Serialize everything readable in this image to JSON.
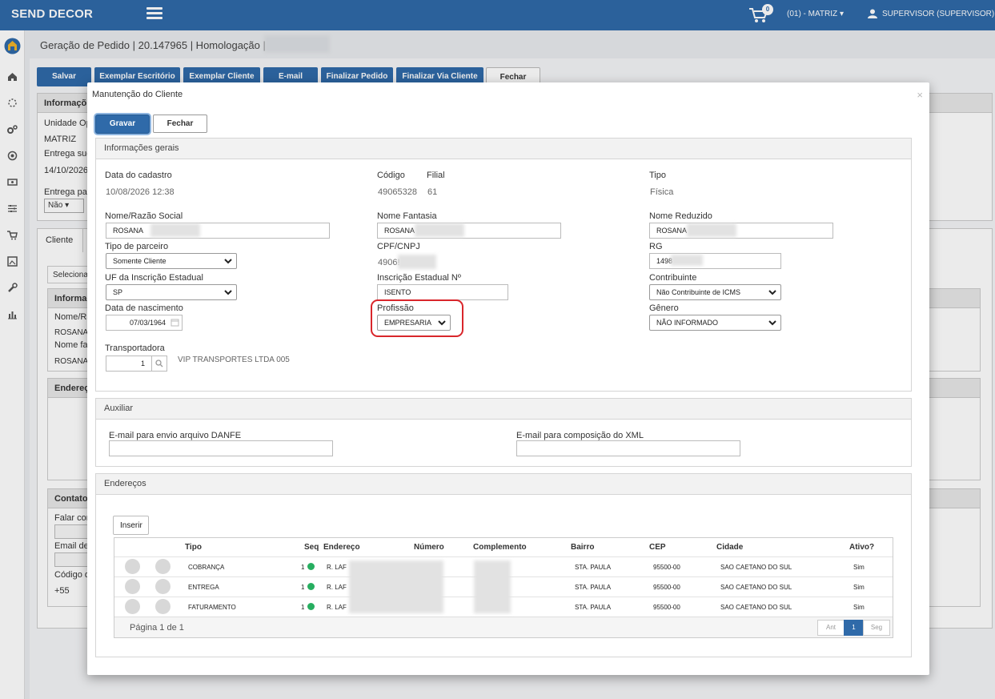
{
  "topbar": {
    "brand": "SEND DECOR",
    "cart_count": "0",
    "unit": "(01) - MATRIZ",
    "user": "SUPERVISOR (SUPERVISOR)"
  },
  "page": {
    "breadcrumb": "Geração de Pedido | 20.147965 | Homologação |",
    "toolbar": [
      "Salvar",
      "Exemplar Escritório",
      "Exemplar Cliente",
      "E-mail",
      "Finalizar Pedido",
      "Finalizar Via Cliente",
      "Fechar"
    ],
    "bg": {
      "panel_info": "Informaçõ",
      "unidade": "Unidade Op",
      "matriz": "MATRIZ",
      "entrega_sug": "Entrega sug",
      "data": "14/10/2026",
      "entrega_pa": "Entrega pa",
      "nao": "Não",
      "tab_cliente": "Cliente",
      "selecionar": "Seleciona",
      "informac": "Informac",
      "nome_ra": "Nome/Ra",
      "rosana1": "ROSANA",
      "nome_fa": "Nome fa",
      "rosana2": "ROSANA",
      "endereco": "Endereç",
      "contato": "Contato",
      "falar_com": "Falar con",
      "email_de": "Email de",
      "codigo": "Código d",
      "ddi": "+55"
    }
  },
  "modal": {
    "title": "Manutenção do Cliente",
    "close": "×",
    "save": "Gravar",
    "close_btn": "Fechar",
    "general": {
      "heading": "Informações gerais",
      "data_cadastro_label": "Data do cadastro",
      "data_cadastro": "10/08/2026 12:38",
      "codigo_label": "Código",
      "codigo": "49065328",
      "filial_label": "Filial",
      "filial": "61",
      "tipo_label": "Tipo",
      "tipo": "Física",
      "nome_label": "Nome/Razão Social",
      "nome": "ROSANA",
      "fantasia_label": "Nome Fantasia",
      "fantasia": "ROSANA",
      "reduzido_label": "Nome Reduzido",
      "reduzido": "ROSANA",
      "parceiro_label": "Tipo de parceiro",
      "parceiro": "Somente Cliente",
      "cpf_label": "CPF/CNPJ",
      "cpf": "4906!",
      "rg_label": "RG",
      "rg": "1498",
      "uf_label": "UF da Inscrição Estadual",
      "uf": "SP",
      "ie_label": "Inscrição Estadual Nº",
      "ie": "ISENTO",
      "contribuinte_label": "Contribuinte",
      "contribuinte": "Não Contribuinte de ICMS",
      "nascimento_label": "Data de nascimento",
      "nascimento": "07/03/1964",
      "profissao_label": "Profissão",
      "profissao": "EMPRESARIA",
      "genero_label": "Gênero",
      "genero": "NÃO INFORMADO",
      "transportadora_label": "Transportadora",
      "transportadora_code": "1",
      "transportadora_name": "VIP TRANSPORTES LTDA 005"
    },
    "auxiliar": {
      "heading": "Auxiliar",
      "danfe_label": "E-mail para envio arquivo DANFE",
      "xml_label": "E-mail para composição do XML"
    },
    "enderecos": {
      "heading": "Endereços",
      "insert": "Inserir",
      "columns": [
        "Tipo",
        "Seq",
        "Endereço",
        "Número",
        "Complemento",
        "Bairro",
        "CEP",
        "Cidade",
        "Ativo?"
      ],
      "rows": [
        {
          "tipo": "COBRANÇA",
          "seq": "1",
          "endereco": "R. LAF",
          "bairro": "STA. PAULA",
          "cep": "95500-00",
          "cidade": "SAO CAETANO DO SUL",
          "ativo": "Sim"
        },
        {
          "tipo": "ENTREGA",
          "seq": "1",
          "endereco": "R. LAF",
          "bairro": "STA. PAULA",
          "cep": "95500-00",
          "cidade": "SAO CAETANO DO SUL",
          "ativo": "Sim"
        },
        {
          "tipo": "FATURAMENTO",
          "seq": "1",
          "endereco": "R. LAF",
          "bairro": "STA. PAULA",
          "cep": "95500-00",
          "cidade": "SAO CAETANO DO SUL",
          "ativo": "Sim"
        }
      ],
      "pagination": "Página 1 de 1",
      "prev": "Ant",
      "page": "1",
      "next": "Seg"
    }
  }
}
